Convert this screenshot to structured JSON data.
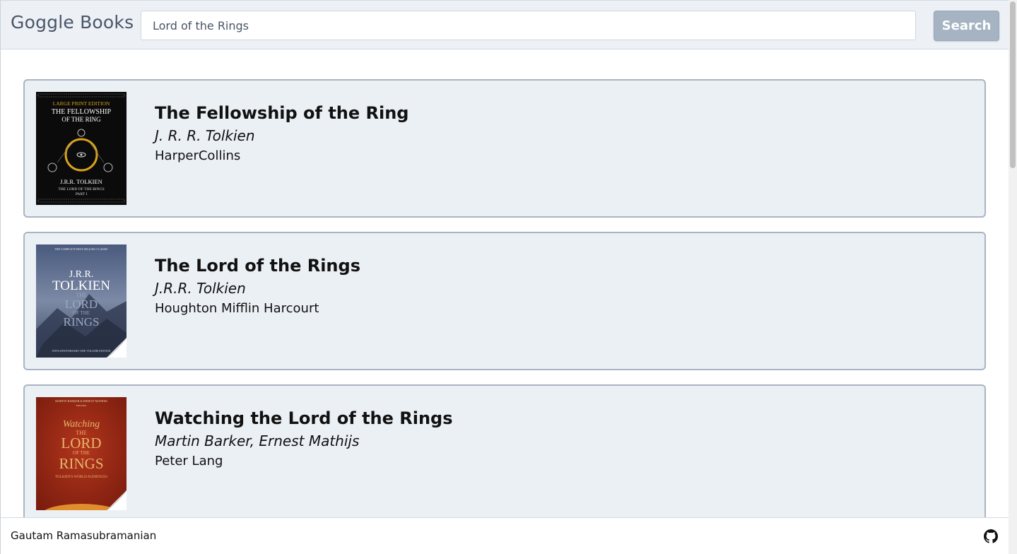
{
  "header": {
    "brand": "Goggle Books",
    "search": {
      "value": "Lord of the Rings",
      "placeholder": ""
    },
    "search_button_label": "Search"
  },
  "results": [
    {
      "title": "The Fellowship of the Ring",
      "author": "J. R. R. Tolkien",
      "publisher": "HarperCollins",
      "cover": {
        "top_line": "LARGE PRINT EDITION",
        "title_line1": "THE FELLOWSHIP",
        "title_line2": "OF THE RING",
        "author_line": "J.R.R. TOLKIEN",
        "sub_line1": "THE LORD OF THE RINGS",
        "sub_line2": "PART I",
        "bg": "#0b0b0b",
        "accent": "#d8a21c"
      }
    },
    {
      "title": "The Lord of the Rings",
      "author": "J.R.R. Tolkien",
      "publisher": "Houghton Mifflin Harcourt",
      "cover": {
        "top_line": "THE COMPLETE BEST-SELLING CLASSIC",
        "name1": "J.R.R.",
        "name2": "TOLKIEN",
        "t1": "THE",
        "t2": "LORD",
        "t3": "OF THE",
        "t4": "RINGS",
        "bottom_line": "50TH ANNIVERSARY ONE VOLUME EDITION",
        "bg": "#5d6c8c"
      }
    },
    {
      "title": "Watching the Lord of the Rings",
      "author": "Martin Barker, Ernest Mathijs",
      "publisher": "Peter Lang",
      "cover": {
        "top_line": "MARTIN BARKER & ERNEST MATHIJS",
        "editors": "EDITORS",
        "w1": "Watching",
        "t1": "THE",
        "t2": "LORD",
        "t3": "OF THE",
        "t4": "RINGS",
        "bottom_line": "TOLKIEN'S WORLD AUDIENCES",
        "bg": "#9e2a17",
        "accent": "#e7b56a"
      }
    }
  ],
  "footer": {
    "name": "Gautam Ramasubramanian",
    "icon": "github-icon"
  }
}
